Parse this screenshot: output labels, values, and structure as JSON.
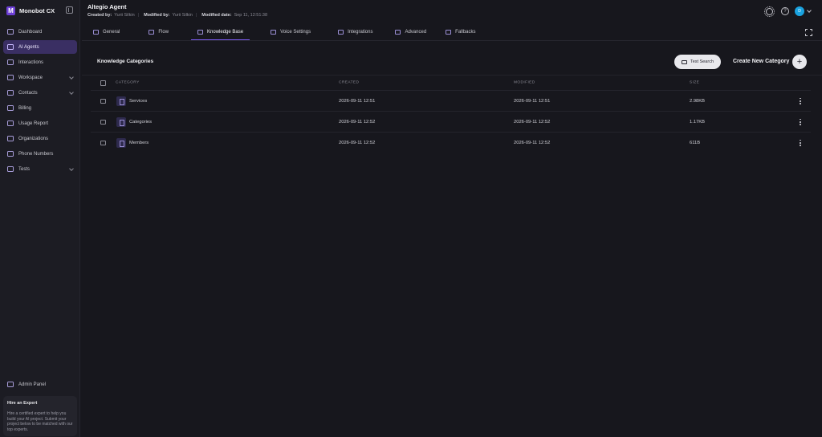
{
  "app": {
    "name": "Monobot CX",
    "logo_letter": "M",
    "accent": "#7c5cf0"
  },
  "sidebar": {
    "items": [
      {
        "label": "Dashboard",
        "icon": "house-icon",
        "active": false
      },
      {
        "label": "AI Agents",
        "icon": "robot-icon",
        "active": true
      },
      {
        "label": "Interactions",
        "icon": "chat-icon",
        "active": false
      },
      {
        "label": "Workspace",
        "icon": "folder-icon",
        "active": false,
        "expandable": true
      },
      {
        "label": "Contacts",
        "icon": "users-icon",
        "active": false,
        "expandable": true
      },
      {
        "label": "Billing",
        "icon": "card-icon",
        "active": false
      },
      {
        "label": "Usage Report",
        "icon": "report-icon",
        "active": false
      },
      {
        "label": "Organizations",
        "icon": "building-icon",
        "active": false
      },
      {
        "label": "Phone Numbers",
        "icon": "phone-icon",
        "active": false
      },
      {
        "label": "Tests",
        "icon": "flask-icon",
        "active": false,
        "expandable": true
      }
    ],
    "admin_label": "Admin Panel",
    "expert": {
      "title": "Hire an Expert",
      "text": "Hire a certified expert to help you build your AI project. Submit your project below to be matched with our top experts."
    }
  },
  "header": {
    "title": "Altegio Agent",
    "created_by_label": "Created by:",
    "created_by": "Yurii Silkin",
    "modified_by_label": "Modified by:",
    "modified_by": "Yurii Silkin",
    "modified_date_label": "Modified date:",
    "modified_date": "Sep 11, 12:51:38",
    "avatar_initial": "D"
  },
  "tabs": [
    {
      "label": "General",
      "icon": "window-icon",
      "active": false
    },
    {
      "label": "Flow",
      "icon": "flow-icon",
      "active": false
    },
    {
      "label": "Knowledge Base",
      "icon": "book-icon",
      "active": true
    },
    {
      "label": "Voice Settings",
      "icon": "voice-icon",
      "active": false
    },
    {
      "label": "Integrations",
      "icon": "puzzle-icon",
      "active": false
    },
    {
      "label": "Advanced",
      "icon": "sliders-icon",
      "active": false
    },
    {
      "label": "Fallbacks",
      "icon": "fallback-icon",
      "active": false
    }
  ],
  "knowledge": {
    "title": "Knowledge Categories",
    "test_search_label": "Test Search",
    "create_label": "Create New Category",
    "create_symbol": "+",
    "columns": {
      "category": "CATEGORY",
      "created": "CREATED",
      "modified": "MODIFIED",
      "size": "SIZE"
    },
    "rows": [
      {
        "name": "Services",
        "created": "2026-09-11 12:51",
        "modified": "2026-09-11 12:51",
        "size": "2.98KB"
      },
      {
        "name": "Categories",
        "created": "2026-09-11 12:52",
        "modified": "2026-09-11 12:52",
        "size": "1.17KB"
      },
      {
        "name": "Members",
        "created": "2026-09-11 12:52",
        "modified": "2026-09-11 12:52",
        "size": "611B"
      }
    ]
  }
}
